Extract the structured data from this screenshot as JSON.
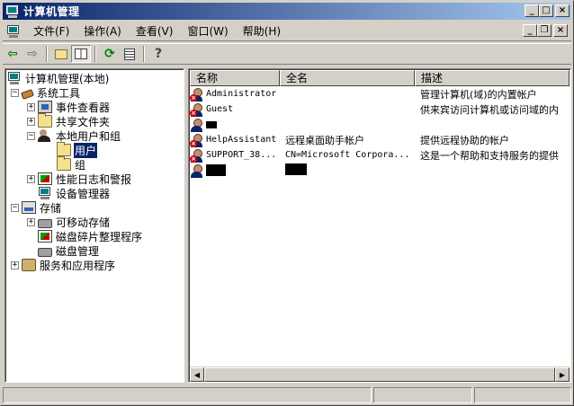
{
  "window": {
    "title": "计算机管理",
    "buttons": {
      "minimize": "_",
      "maximize": "□",
      "close": "×"
    }
  },
  "menu": {
    "items": [
      "文件(F)",
      "操作(A)",
      "查看(V)",
      "窗口(W)",
      "帮助(H)"
    ],
    "mdi_buttons": {
      "minimize": "_",
      "restore": "❐",
      "close": "×"
    }
  },
  "toolbar": {
    "icons": [
      "back-arrow-icon",
      "forward-arrow-icon",
      "up-folder-icon",
      "show-hide-tree-icon",
      "refresh-icon",
      "export-list-icon",
      "help-icon"
    ]
  },
  "tree": {
    "root": "计算机管理(本地)",
    "items": [
      {
        "label": "系统工具",
        "expander": "−"
      },
      {
        "label": "事件查看器",
        "expander": "+"
      },
      {
        "label": "共享文件夹",
        "expander": "+"
      },
      {
        "label": "本地用户和组",
        "expander": "−"
      },
      {
        "label": "用户",
        "expander": ""
      },
      {
        "label": "组",
        "expander": ""
      },
      {
        "label": "性能日志和警报",
        "expander": "+"
      },
      {
        "label": "设备管理器",
        "expander": ""
      },
      {
        "label": "存储",
        "expander": "−"
      },
      {
        "label": "可移动存储",
        "expander": "+"
      },
      {
        "label": "磁盘碎片整理程序",
        "expander": ""
      },
      {
        "label": "磁盘管理",
        "expander": ""
      },
      {
        "label": "服务和应用程序",
        "expander": "+"
      }
    ]
  },
  "list": {
    "columns": [
      "名称",
      "全名",
      "描述"
    ],
    "rows": [
      {
        "name": "Administrator",
        "fullname": "",
        "desc": "管理计算机(域)的内置帐户"
      },
      {
        "name": "Guest",
        "fullname": "",
        "desc": "供来宾访问计算机或访问域的内"
      },
      {
        "name": "",
        "fullname": "",
        "desc": ""
      },
      {
        "name": "HelpAssistant",
        "fullname": "远程桌面助手帐户",
        "desc": "提供远程协助的帐户"
      },
      {
        "name": "SUPPORT_38...",
        "fullname": "CN=Microsoft Corpora...",
        "desc": "这是一个帮助和支持服务的提供"
      },
      {
        "name": "",
        "fullname": "",
        "desc": ""
      }
    ]
  },
  "scrollbar": {
    "left": "◀",
    "right": "▶"
  }
}
